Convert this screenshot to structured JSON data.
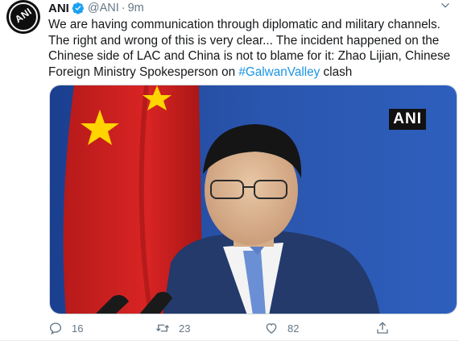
{
  "tweet": {
    "author_name": "ANI",
    "handle": "@ANI",
    "separator": "·",
    "time": "9m",
    "avatar_text": "ANI",
    "text_before_hashtag": "We are having communication through diplomatic and military channels. The right and wrong of this is very clear... The incident happened on the Chinese side of LAC and China is not to blame for it: Zhao Lijian, Chinese Foreign Ministry Spokesperson on ",
    "hashtag": "#GalwanValley",
    "text_after_hashtag": " clash",
    "media_watermark": "ANI"
  },
  "actions": {
    "reply_count": "16",
    "retweet_count": "23",
    "like_count": "82"
  },
  "colors": {
    "accent": "#1b95e0",
    "muted": "#657786",
    "verified": "#1da1f2"
  }
}
